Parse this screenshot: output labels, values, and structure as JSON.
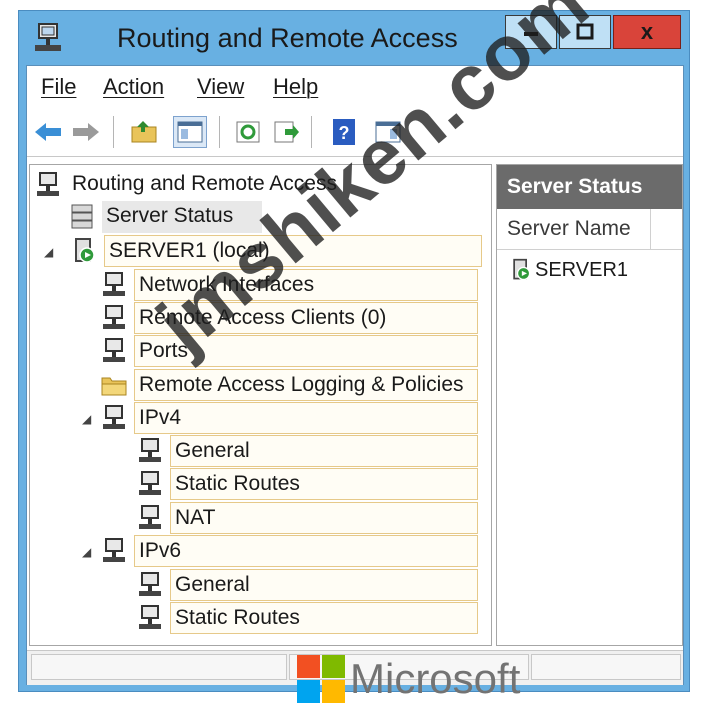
{
  "window": {
    "title": "Routing and Remote Access",
    "min_glyph": "▬",
    "max_glyph": "☐",
    "close_glyph": "x"
  },
  "menu": {
    "items": [
      "File",
      "Action",
      "View",
      "Help"
    ]
  },
  "toolbar": {
    "buttons": [
      "back-icon",
      "forward-icon",
      "up-folder-icon",
      "show-hide-tree-icon",
      "refresh-icon",
      "export-list-icon",
      "help-icon",
      "properties-pane-icon"
    ]
  },
  "tree": {
    "root": "Routing and Remote Access",
    "server_status": "Server Status",
    "server": "SERVER1 (local)",
    "network_interfaces": "Network Interfaces",
    "remote_access_clients": "Remote Access Clients (0)",
    "ports": "Ports",
    "logging_policies": "Remote Access Logging & Policies",
    "ipv4": "IPv4",
    "ipv4_general": "General",
    "ipv4_static_routes": "Static Routes",
    "ipv4_nat": "NAT",
    "ipv6": "IPv6",
    "ipv6_general": "General",
    "ipv6_static_routes": "Static Routes"
  },
  "details": {
    "header": "Server Status",
    "column_server_name": "Server Name",
    "rows": [
      "SERVER1"
    ]
  },
  "watermark": {
    "text": "jmshiken.com"
  },
  "branding": {
    "text": "Microsoft",
    "colors": [
      "#f25022",
      "#7fba00",
      "#00a4ef",
      "#ffb900"
    ]
  },
  "colors": {
    "title_bar": "#68b0e2",
    "close_button": "#d9443a",
    "highlight_border": "#e6c989",
    "details_header": "#6b6b6b"
  }
}
